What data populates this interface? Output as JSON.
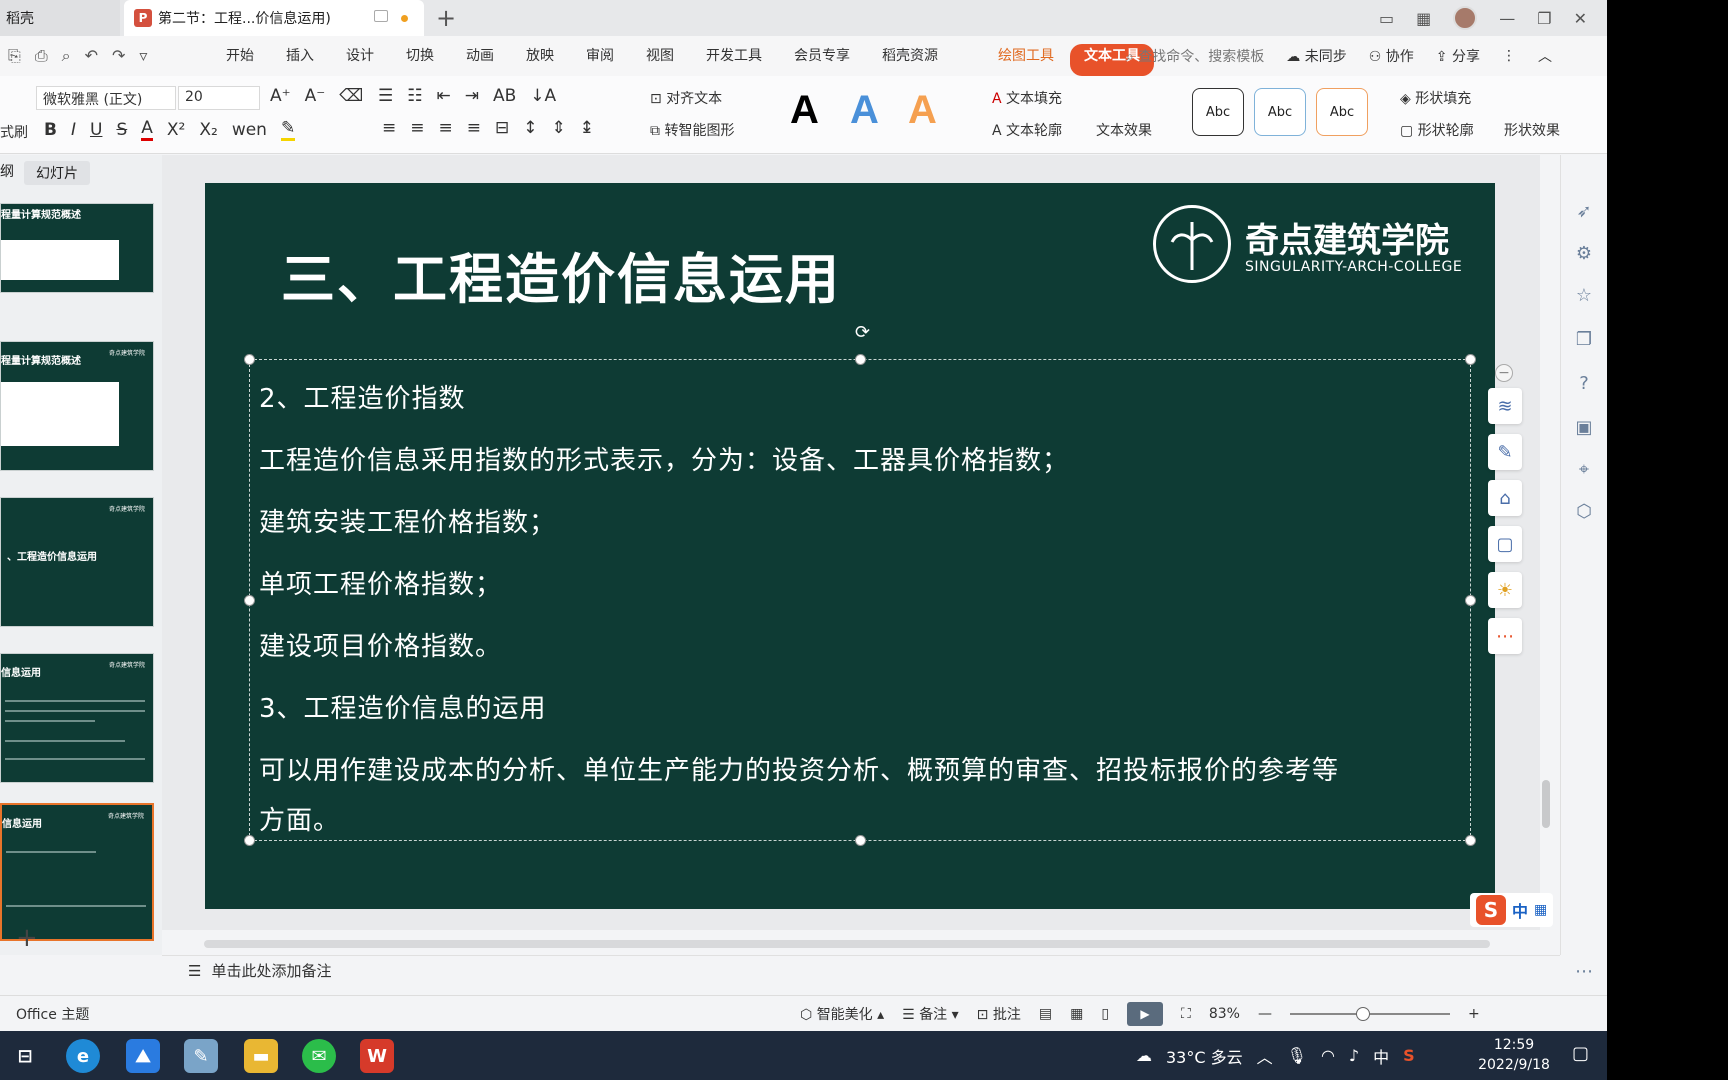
{
  "titlebar": {
    "home_tab": "稻壳",
    "doc_tab": "第二节：工程...价信息运用)",
    "new_tab": "+"
  },
  "quick_access": [
    "⎘",
    "⎙",
    "⌕",
    "↶",
    "↷",
    "▿"
  ],
  "menus": [
    "开始",
    "插入",
    "设计",
    "切换",
    "动画",
    "放映",
    "审阅",
    "视图",
    "开发工具",
    "会员专享",
    "稻壳资源"
  ],
  "menu_tools": {
    "draw": "绘图工具",
    "text": "文本工具"
  },
  "menu_right": {
    "search": "查找命令、搜索模板",
    "sync": "未同步",
    "collab": "协作",
    "share": "分享"
  },
  "ribbon": {
    "font_name": "微软雅黑 (正文)",
    "font_size": "20",
    "format_brush": "式刷",
    "align_text": "对齐文本",
    "smart_shape": "转智能图形",
    "text_fill": "文本填充",
    "text_outline": "文本轮廓",
    "text_effect": "文本效果",
    "shape_fill": "形状填充",
    "shape_outline": "形状轮廓",
    "shape_effect": "形状效果",
    "abc": [
      "Abc",
      "Abc",
      "Abc"
    ],
    "big_a": [
      "A",
      "A",
      "A"
    ]
  },
  "left_panel": {
    "tab_outline": "纲",
    "tab_slides": "幻灯片",
    "thumbs": [
      {
        "title": "程量计算规范概述"
      },
      {
        "title": "程量计算规范概述"
      },
      {
        "title": "、工程造价信息运用"
      },
      {
        "title": "信息运用"
      },
      {
        "title": "信息运用"
      }
    ]
  },
  "slide": {
    "title": "三、工程造价信息运用",
    "brand_cn": "奇点建筑学院",
    "brand_en": "SINGULARITY-ARCH-COLLEGE",
    "lines": [
      "2、工程造价指数",
      "工程造价信息采用指数的形式表示，分为：设备、工器具价格指数；",
      "建筑安装工程价格指数；",
      "单项工程价格指数；",
      "建设项目价格指数。",
      "3、工程造价信息的运用",
      "可以用作建设成本的分析、单位生产能力的投资分析、概预算的审查、招投标报价的参考等",
      "方面。"
    ]
  },
  "notes_placeholder": "单击此处添加备注",
  "statusbar": {
    "theme": "Office 主题",
    "smart_beautify": "智能美化",
    "notes": "备注",
    "comments": "批注",
    "zoom": "83%"
  },
  "ime": {
    "lang": "中"
  },
  "taskbar": {
    "weather": "33°C 多云",
    "ime_lang": "中",
    "time": "12:59",
    "date": "2022/9/18"
  }
}
